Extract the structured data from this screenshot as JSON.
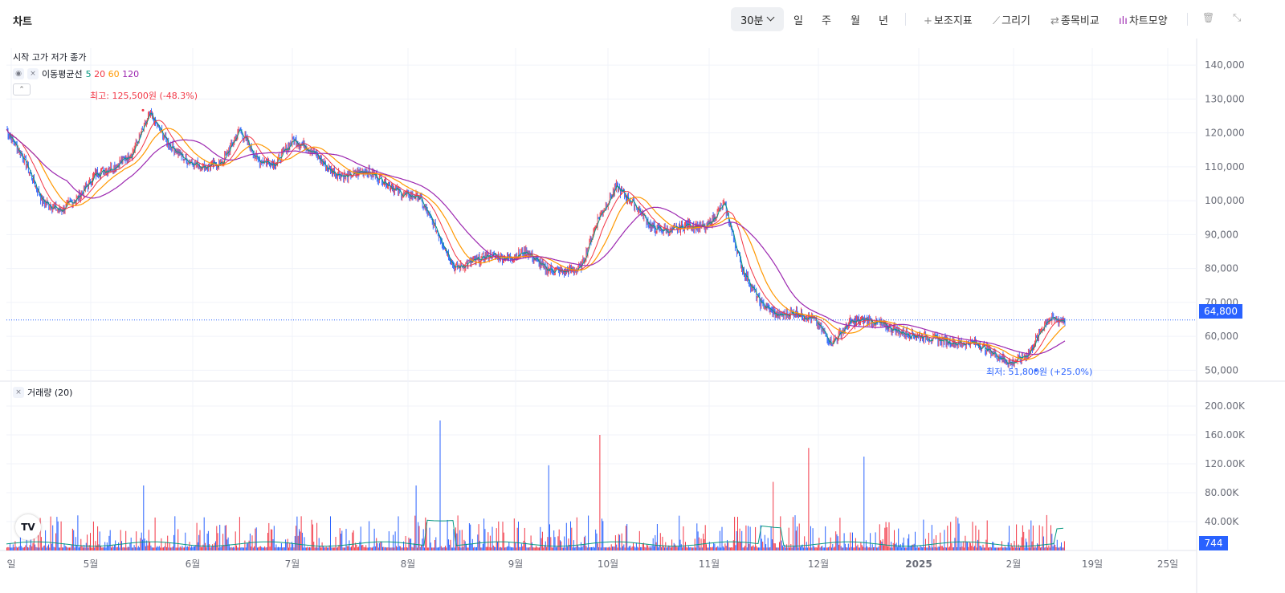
{
  "topbar": {
    "title": "차트",
    "interval": "30분",
    "periods": [
      "일",
      "주",
      "월",
      "년"
    ],
    "tools": [
      {
        "icon": "plus-icon",
        "glyph": "+",
        "label": "보조지표"
      },
      {
        "icon": "pencil-icon",
        "glyph": "⟋",
        "label": "그리기"
      },
      {
        "icon": "compare-icon",
        "glyph": "⇄",
        "label": "종목비교"
      },
      {
        "icon": "candles-icon",
        "glyph": "ılı",
        "label": "차트모양"
      }
    ],
    "trash_glyph": "🗑",
    "collapse_glyph": "⤡"
  },
  "legend": {
    "ohlc_text": "시작 고가 저가 종가",
    "ma_label": "이동평균선",
    "ma_periods": [
      {
        "label": "5",
        "color": "#089981"
      },
      {
        "label": "20",
        "color": "#f23645"
      },
      {
        "label": "60",
        "color": "#ff9800"
      },
      {
        "label": "120",
        "color": "#9c27b0"
      }
    ],
    "eye_glyph": "◉",
    "close_glyph": "×",
    "collapse_glyph": "⌃"
  },
  "volume_legend": {
    "label": "거래량 (20)",
    "close_glyph": "×"
  },
  "annotations": {
    "high": "최고: 125,500원 (-48.3%)",
    "low": "최저: 51,800원 (+25.0%)"
  },
  "price_axis": {
    "ticks": [
      "140,000",
      "130,000",
      "120,000",
      "110,000",
      "100,000",
      "90,000",
      "80,000",
      "70,000",
      "60,000",
      "50,000"
    ],
    "current_price": "64,800"
  },
  "volume_axis": {
    "ticks": [
      "200.00K",
      "160.00K",
      "120.00K",
      "80.00K",
      "40.00K"
    ],
    "current_volume": "744"
  },
  "time_axis": {
    "ticks": [
      "일",
      "5월",
      "6월",
      "7월",
      "8월",
      "9월",
      "10월",
      "11월",
      "12월",
      "2025",
      "2월",
      "19일",
      "25일"
    ]
  },
  "logo_text": "TV",
  "colors": {
    "up": "#f23645",
    "down": "#2962ff",
    "accent": "#2962ff"
  },
  "chart_data": {
    "type": "candlestick",
    "interval": "30분",
    "ylim": [
      47000,
      145000
    ],
    "high": 125500,
    "low": 51800,
    "last": 64800,
    "close_path": [
      [
        "일",
        121000
      ],
      [
        "",
        112000
      ],
      [
        "",
        100000
      ],
      [
        "",
        97000
      ],
      [
        "",
        101000
      ],
      [
        "5월",
        108000
      ],
      [
        "",
        110000
      ],
      [
        "",
        114000
      ],
      [
        "",
        125500
      ],
      [
        "",
        117000
      ],
      [
        "",
        112000
      ],
      [
        "6월",
        110000
      ],
      [
        "",
        111000
      ],
      [
        "",
        121000
      ],
      [
        "",
        112000
      ],
      [
        "",
        111000
      ],
      [
        "7월",
        118000
      ],
      [
        "",
        115000
      ],
      [
        "",
        109000
      ],
      [
        "",
        107000
      ],
      [
        "",
        109000
      ],
      [
        "",
        106000
      ],
      [
        "",
        102000
      ],
      [
        "8월",
        101000
      ],
      [
        "",
        91000
      ],
      [
        "",
        80000
      ],
      [
        "",
        82000
      ],
      [
        "9월",
        84000
      ],
      [
        "",
        83000
      ],
      [
        "",
        85000
      ],
      [
        "",
        80000
      ],
      [
        "",
        79000
      ],
      [
        "",
        80000
      ],
      [
        "10월",
        95000
      ],
      [
        "",
        104000
      ],
      [
        "",
        99000
      ],
      [
        "",
        92000
      ],
      [
        "",
        91000
      ],
      [
        "",
        93000
      ],
      [
        "",
        92000
      ],
      [
        "11월",
        99000
      ],
      [
        "",
        80000
      ],
      [
        "",
        70000
      ],
      [
        "",
        66000
      ],
      [
        "",
        67000
      ],
      [
        "12월",
        65000
      ],
      [
        "",
        58000
      ],
      [
        "",
        64000
      ],
      [
        "",
        65000
      ],
      [
        "",
        63000
      ],
      [
        "2025",
        61000
      ],
      [
        "",
        60000
      ],
      [
        "",
        59000
      ],
      [
        "",
        58000
      ],
      [
        "2월",
        58000
      ],
      [
        "",
        55000
      ],
      [
        "",
        52000
      ],
      [
        "",
        55000
      ],
      [
        "",
        65000
      ],
      [
        "",
        64800
      ]
    ]
  }
}
